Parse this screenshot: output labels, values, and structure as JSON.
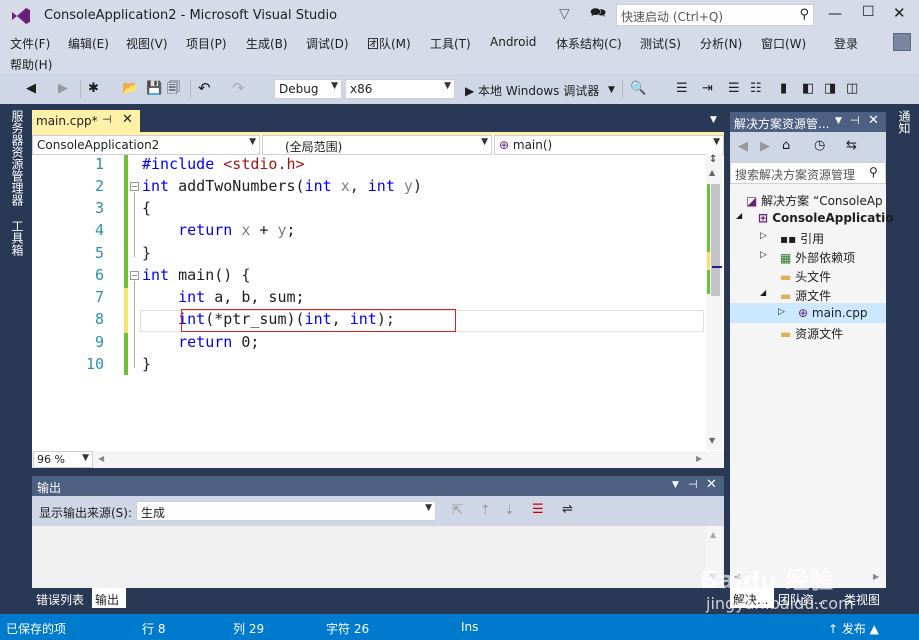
{
  "title": {
    "window_title": "ConsoleApplication2 - Microsoft Visual Studio",
    "quick_launch_placeholder": "快速启动 (Ctrl+Q)"
  },
  "menu": [
    "文件(F)",
    "编辑(E)",
    "视图(V)",
    "项目(P)",
    "生成(B)",
    "调试(D)",
    "团队(M)",
    "工具(T)",
    "Android",
    "体系结构(C)",
    "测试(S)",
    "分析(N)",
    "窗口(W)",
    "登录",
    "帮助(H)"
  ],
  "toolbar": {
    "config": "Debug",
    "platform": "x86",
    "run_label": "▶ 本地 Windows 调试器"
  },
  "left_tabs": [
    "服务器资源管理器",
    "工具箱"
  ],
  "right_tabs": [
    "通知"
  ],
  "editor": {
    "tab_name": "main.cpp*",
    "project_combo": "ConsoleApplication2",
    "scope_combo": "(全局范围)",
    "member_combo": "main()",
    "zoom": "96 %",
    "line_numbers": [
      "1",
      "2",
      "3",
      "4",
      "5",
      "6",
      "7",
      "8",
      "9",
      "10"
    ]
  },
  "output": {
    "title": "输出",
    "source_label": "显示输出来源(S):",
    "source_value": "生成",
    "tabs": [
      "错误列表",
      "输出"
    ]
  },
  "solution_explorer": {
    "title": "解决方案资源管...",
    "search_placeholder": "搜索解决方案资源管理",
    "items": [
      "解决方案 “ConsoleAp",
      "ConsoleApplicatio",
      "引用",
      "外部依赖项",
      "头文件",
      "源文件",
      "main.cpp",
      "资源文件"
    ],
    "tabs": [
      "解决...",
      "团队资...",
      "类视图"
    ]
  },
  "status": {
    "saved": "已保存的项",
    "line": "行 8",
    "col": "列 29",
    "char": "字符 26",
    "mode": "Ins",
    "publish": "↑ 发布 ▲"
  },
  "watermark": {
    "text1": "Baidu 经验",
    "text2": "jingyan.baidu.com"
  }
}
